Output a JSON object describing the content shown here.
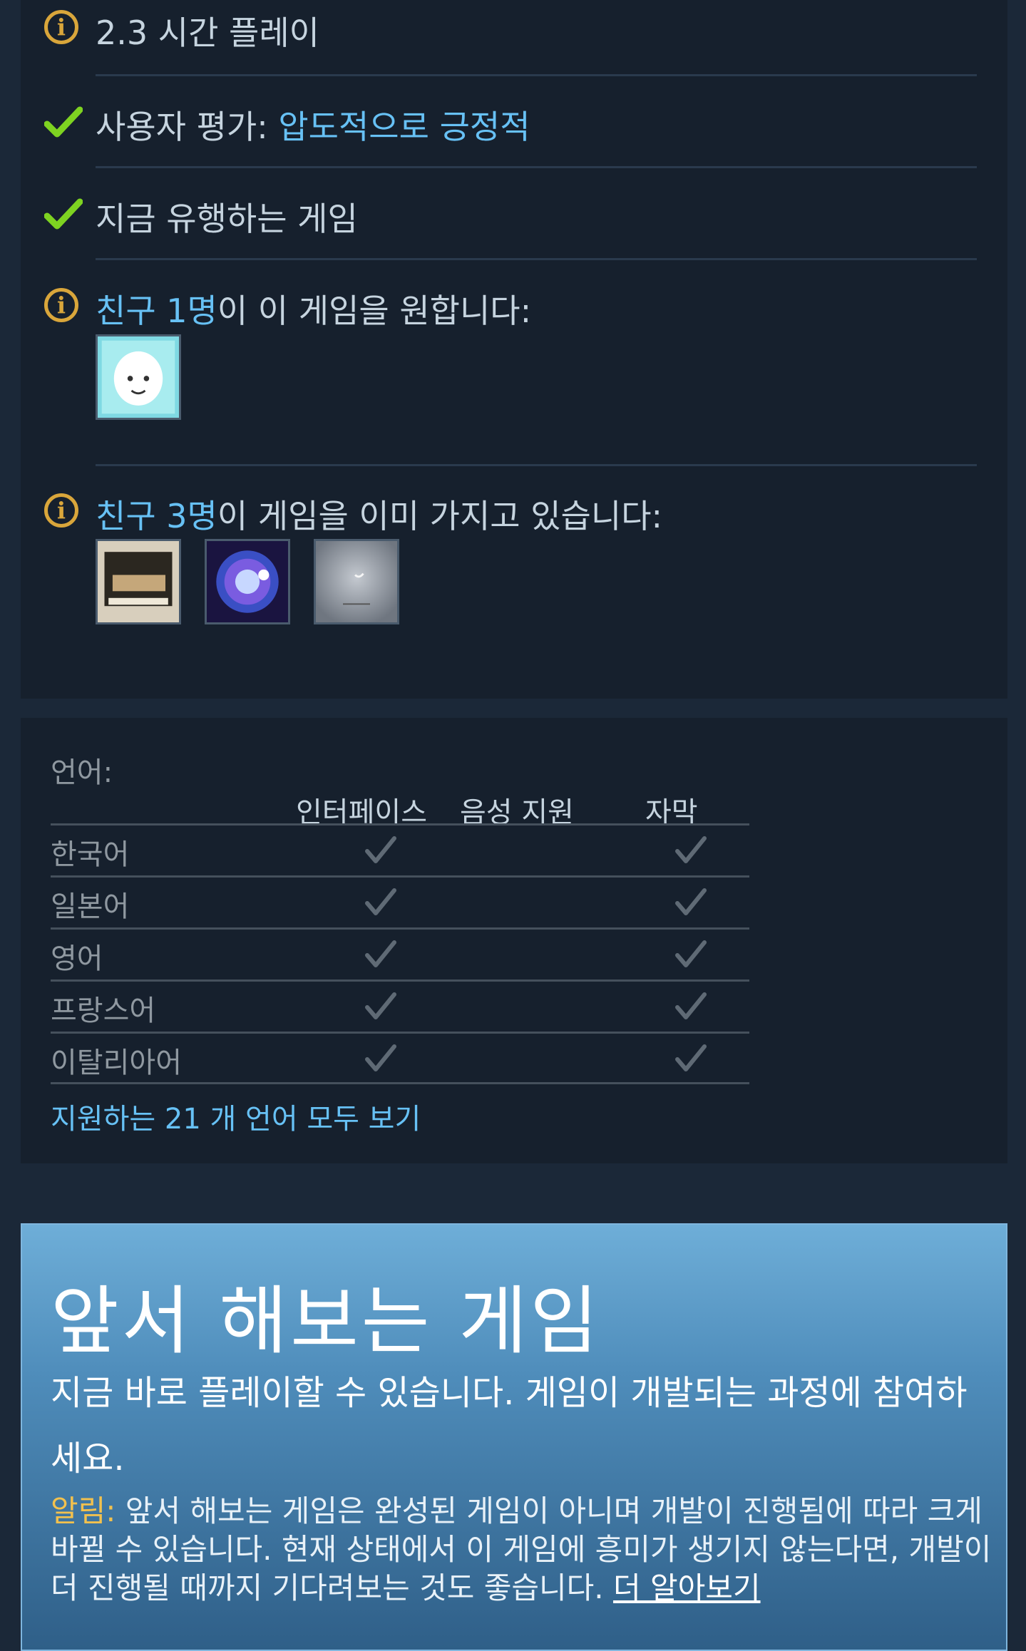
{
  "highlights": {
    "playtime": "2.3 시간 플레이",
    "review_label": "사용자 평가: ",
    "review_value": "압도적으로 긍정적",
    "trending": "지금 유행하는 게임",
    "friends_want_count": "친구 1명",
    "friends_want_suffix": "이 이 게임을 원합니다:",
    "friends_own_count": "친구 3명",
    "friends_own_suffix": "이 게임을 이미 가지고 있습니다:"
  },
  "languages": {
    "title": "언어:",
    "columns": [
      "인터페이스",
      "음성 지원",
      "자막"
    ],
    "rows": [
      {
        "name": "한국어",
        "interface": true,
        "audio": false,
        "subtitles": true
      },
      {
        "name": "일본어",
        "interface": true,
        "audio": false,
        "subtitles": true
      },
      {
        "name": "영어",
        "interface": true,
        "audio": false,
        "subtitles": true
      },
      {
        "name": "프랑스어",
        "interface": true,
        "audio": false,
        "subtitles": true
      },
      {
        "name": "이탈리아어",
        "interface": true,
        "audio": false,
        "subtitles": true
      }
    ],
    "all_link": "지원하는 21 개 언어 모두 보기"
  },
  "early_access": {
    "title": "앞서 해보는 게임",
    "subtitle": "지금 바로 플레이할 수 있습니다. 게임이 개발되는 과정에 참여하세요.",
    "note_label": "알림: ",
    "note_text": "앞서 해보는 게임은 완성된 게임이 아니며 개발이 진행됨에 따라 크게 바뀔 수 있습니다. 현재 상태에서 이 게임에 흥미가 생기지 않는다면, 개발이 더 진행될 때까지 기다려보는 것도 좋습니다. ",
    "note_link": "더 알아보기"
  },
  "colors": {
    "background": "#1b2838",
    "panel": "#16202d",
    "link": "#67c1f5",
    "info_icon": "#d9a63b",
    "check": "#7ed321",
    "warning": "#f2c14e"
  },
  "icons": {
    "info": "info-icon",
    "check": "checkmark-icon",
    "lang_check": "language-checkmark-icon"
  }
}
